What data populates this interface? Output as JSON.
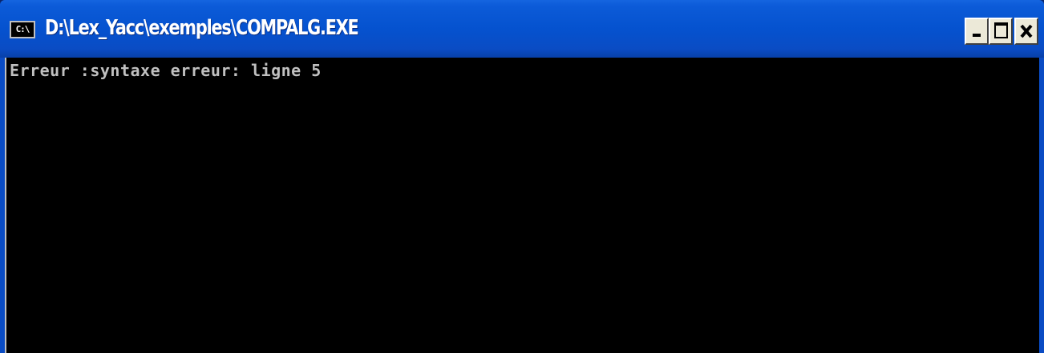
{
  "window": {
    "title": "D:\\Lex_Yacc\\exemples\\COMPALG.EXE",
    "icon_label": "C:\\"
  },
  "controls": {
    "minimize": "minimize-icon",
    "maximize": "maximize-icon",
    "close": "close-icon"
  },
  "console": {
    "lines": [
      "Erreur :syntaxe erreur: ligne 5"
    ]
  },
  "colors": {
    "titlebar": "#0552cf",
    "console_bg": "#000000",
    "console_text": "#c0c0c0",
    "button_face": "#ece9d8"
  }
}
